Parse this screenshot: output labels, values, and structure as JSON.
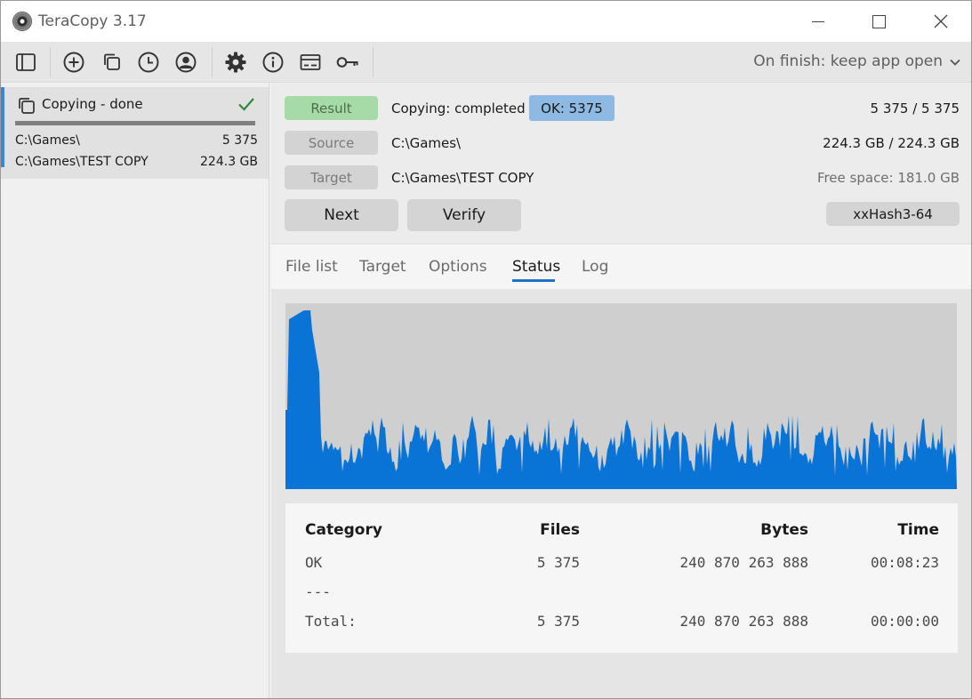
{
  "window": {
    "title": "TeraCopy 3.17"
  },
  "toolbar": {
    "icons": [
      "panel-toggle-icon",
      "add-icon",
      "copy-icon",
      "history-icon",
      "account-icon",
      "gear-icon",
      "info-icon",
      "card-icon",
      "key-icon"
    ],
    "on_finish_label": "On finish: keep app open"
  },
  "job": {
    "title": "Copying - done",
    "progress": 1.0,
    "source_path": "C:\\Games\\",
    "source_count": "5 375",
    "target_path": "C:\\Games\\TEST COPY",
    "target_size": "224.3 GB"
  },
  "details": {
    "result_label": "Result",
    "result_text": "Copying: completed",
    "ok_badge": "OK: 5375",
    "files_progress": "5 375 / 5 375",
    "source_label": "Source",
    "source_path": "C:\\Games\\",
    "bytes_progress": "224.3 GB / 224.3 GB",
    "target_label": "Target",
    "target_path": "C:\\Games\\TEST COPY",
    "free_space": "Free space: 181.0 GB",
    "next_label": "Next",
    "verify_label": "Verify",
    "hash_label": "xxHash3-64"
  },
  "tabs": [
    {
      "label": "File list",
      "active": false
    },
    {
      "label": "Target",
      "active": false
    },
    {
      "label": "Options",
      "active": false
    },
    {
      "label": "Status",
      "active": true
    },
    {
      "label": "Log",
      "active": false
    }
  ],
  "graph": {
    "fill_color": "#0a74d6",
    "background_color": "#cfcfcf"
  },
  "stats": {
    "headers": [
      "Category",
      "Files",
      "Bytes",
      "Time"
    ],
    "rows": [
      {
        "category": "OK",
        "files": "5 375",
        "bytes": "240 870 263 888",
        "time": "00:08:23"
      },
      {
        "category": "---",
        "files": "",
        "bytes": "",
        "time": ""
      },
      {
        "category": "Total:",
        "files": "5 375",
        "bytes": "240 870 263 888",
        "time": "00:00:00"
      }
    ]
  }
}
